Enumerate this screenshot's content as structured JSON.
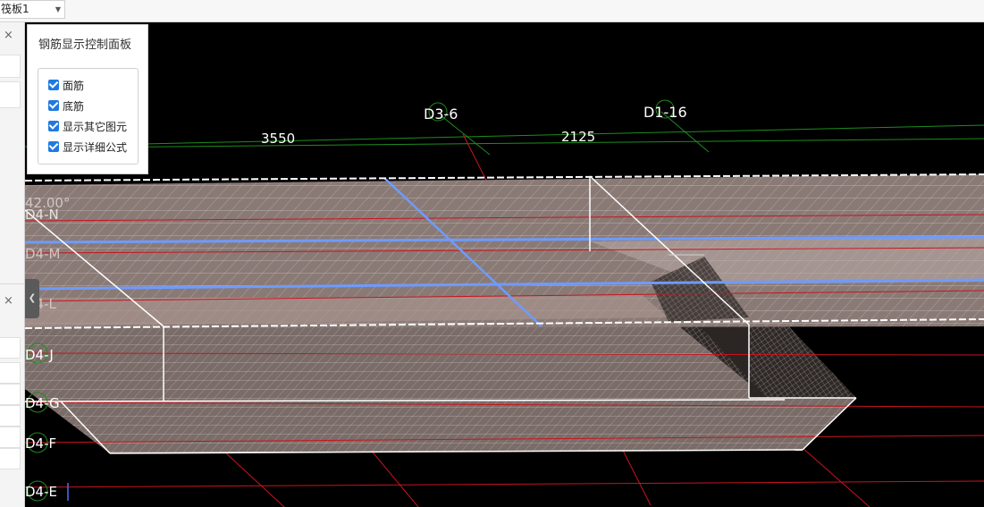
{
  "toolbar": {
    "selector_value": "筏板1"
  },
  "left_panel": {
    "close_symbol": "×"
  },
  "control_panel": {
    "title": "钢筋显示控制面板",
    "options": [
      {
        "label": "面筋",
        "checked": true
      },
      {
        "label": "底筋",
        "checked": true
      },
      {
        "label": "显示其它图元",
        "checked": true
      },
      {
        "label": "显示详细公式",
        "checked": true
      }
    ]
  },
  "viewport": {
    "grid_labels": {
      "d3_6": "D3-6",
      "d1_16": "D1-16",
      "d4_n": "D4-N",
      "d4_m": "D4-M",
      "d4_l": "D4-L",
      "d4_j": "D4-J",
      "d4_g": "D4-G",
      "d4_f": "D4-F",
      "d4_e": "D4-E"
    },
    "dimensions": {
      "dim_1": "3550",
      "dim_2": "2125"
    },
    "angle_label": "42.00°",
    "colors": {
      "background": "#000000",
      "slab_fill": "#8a7a76",
      "grid_line_red": "#c8141e",
      "grid_line_green": "#1e8c1e",
      "top_rebar_blue": "#6e9bff",
      "edge_white": "#ffffff"
    }
  }
}
